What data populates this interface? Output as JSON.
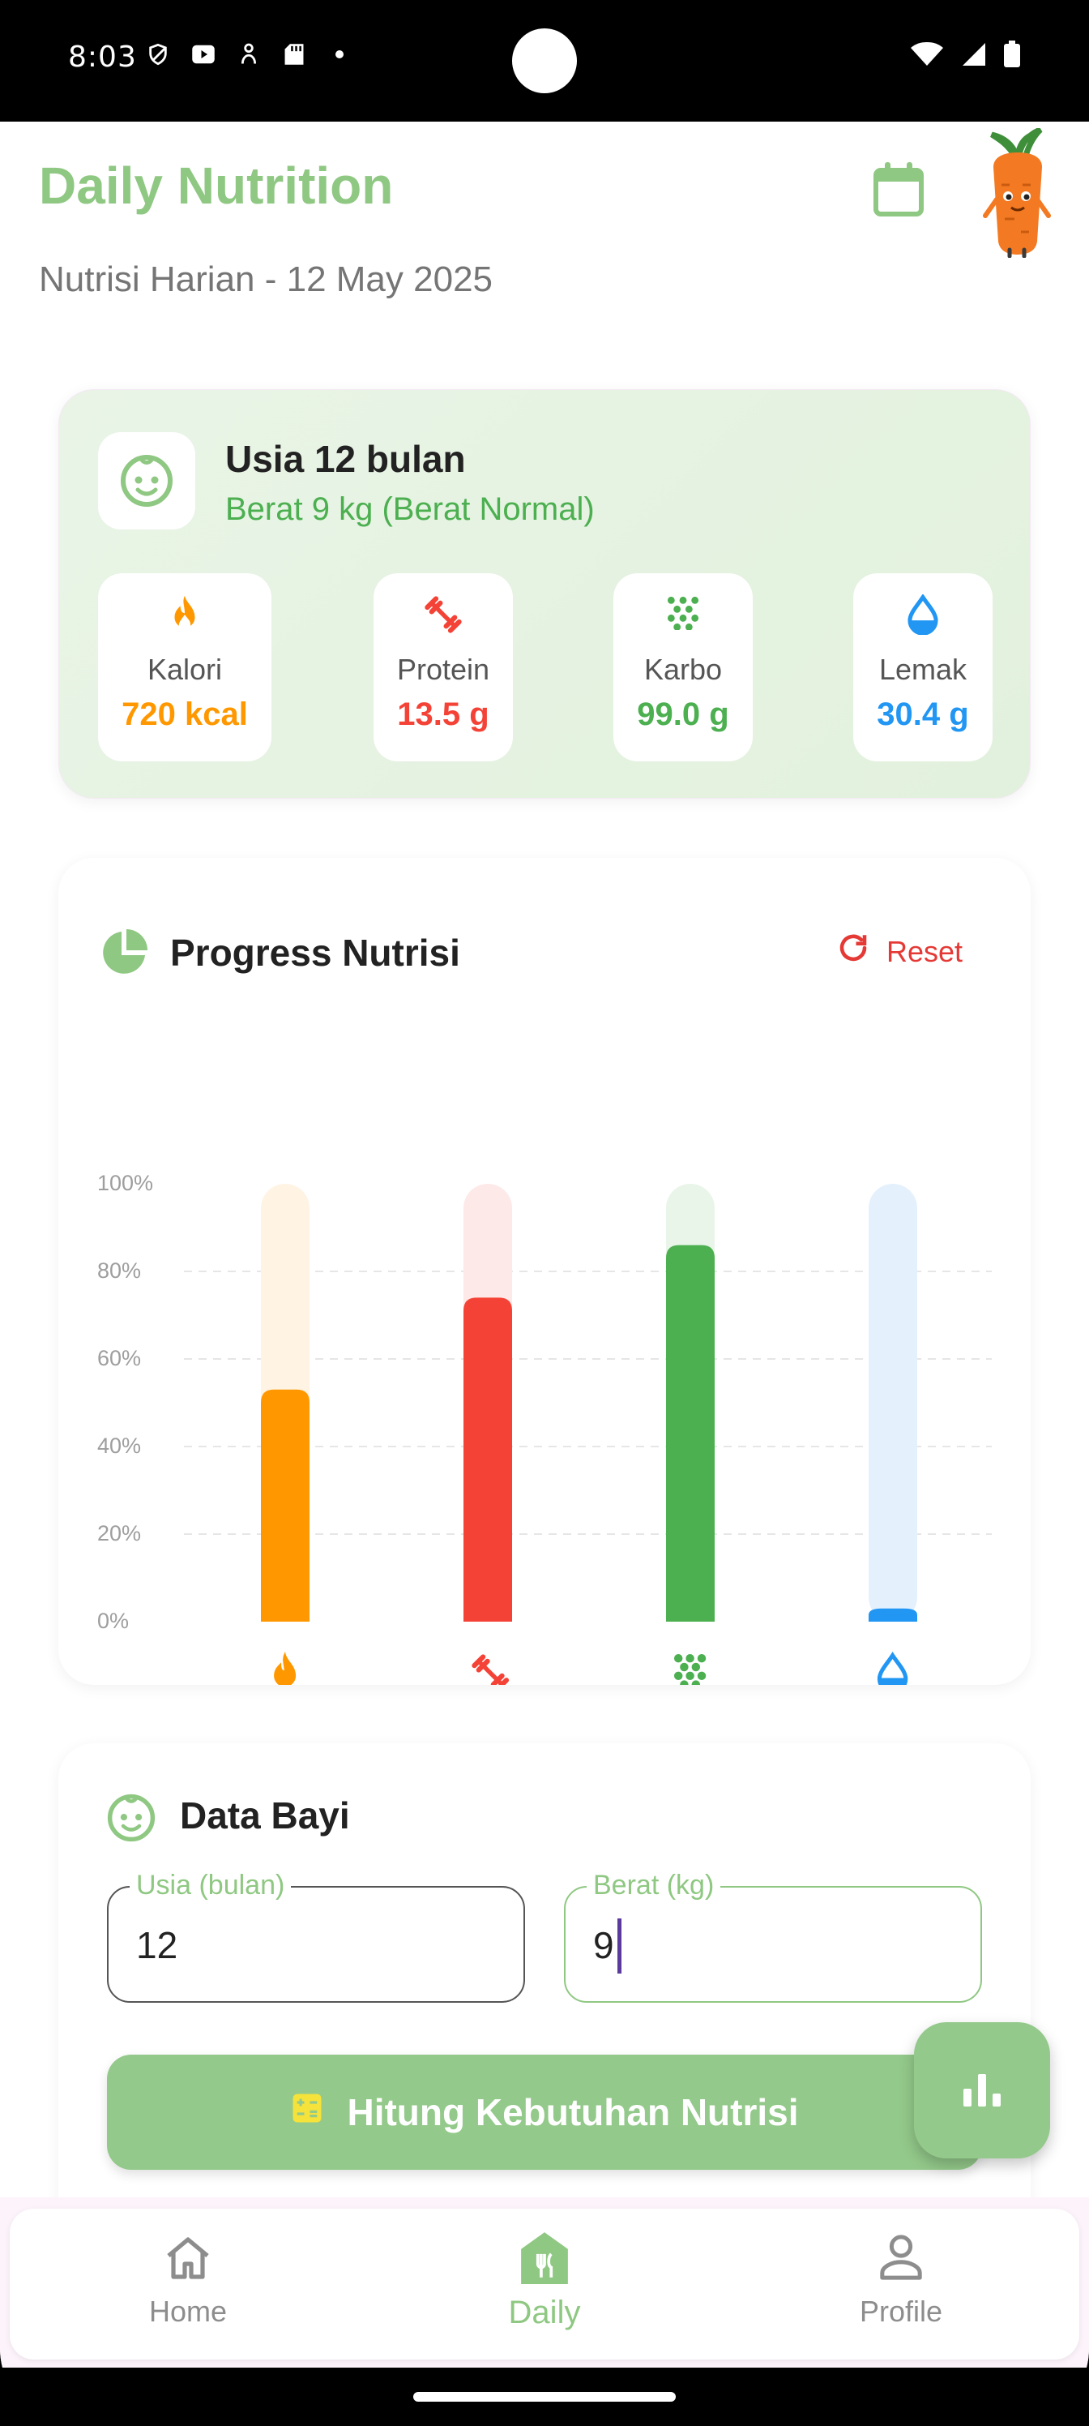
{
  "status_bar": {
    "time": "8:03"
  },
  "header": {
    "title": "Daily Nutrition",
    "subtitle": "Nutrisi Harian - 12 May 2025"
  },
  "profile": {
    "age": "Usia 12 bulan",
    "weight": "Berat 9 kg (Berat Normal)",
    "nutrients": [
      {
        "label": "Kalori",
        "value": "720 kcal",
        "color": "#ff9800",
        "icon": "fire-icon"
      },
      {
        "label": "Protein",
        "value": "13.5 g",
        "color": "#f44336",
        "icon": "dumbbell-icon"
      },
      {
        "label": "Karbo",
        "value": "99.0 g",
        "color": "#4caf50",
        "icon": "grain-icon"
      },
      {
        "label": "Lemak",
        "value": "30.4 g",
        "color": "#2196f3",
        "icon": "water-drop-icon"
      }
    ]
  },
  "progress": {
    "title": "Progress Nutrisi",
    "reset_label": "Reset"
  },
  "chart_data": {
    "type": "bar",
    "categories": [
      "Kalori",
      "Protein",
      "Karbo",
      "Lemak"
    ],
    "values": [
      53,
      74,
      86,
      3
    ],
    "ylim": [
      0,
      100
    ],
    "yticks": [
      "0%",
      "20%",
      "40%",
      "60%",
      "80%",
      "100%"
    ],
    "colors": [
      "#ff9800",
      "#f44336",
      "#4caf50",
      "#2196f3"
    ],
    "track_colors": [
      "#fff3e4",
      "#fde9e8",
      "#e9f5e9",
      "#e4f1fd"
    ],
    "grid": true
  },
  "baby_data": {
    "title": "Data Bayi",
    "age_label": "Usia (bulan)",
    "age_value": "12",
    "weight_label": "Berat (kg)",
    "weight_value": "9",
    "button_label": "Hitung Kebutuhan Nutrisi"
  },
  "nav": {
    "home": "Home",
    "daily": "Daily",
    "profile": "Profile"
  }
}
